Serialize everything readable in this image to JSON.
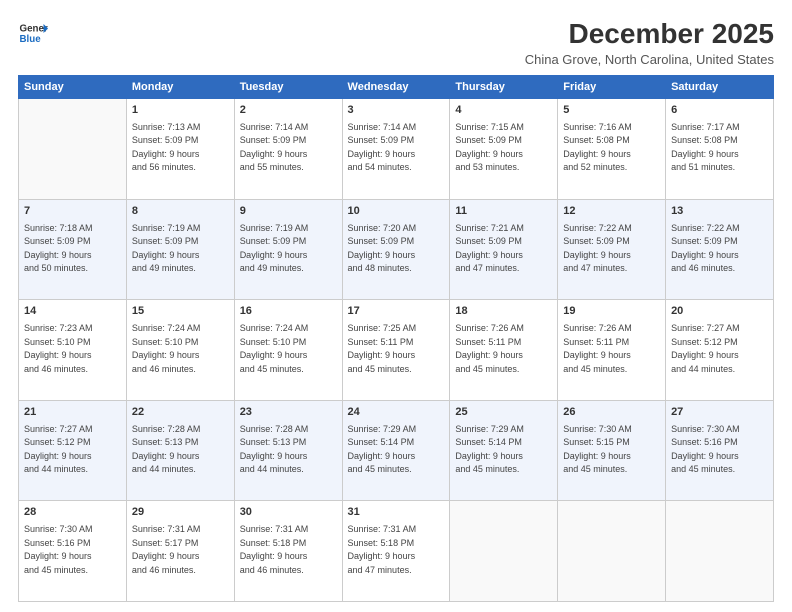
{
  "header": {
    "logo_line1": "General",
    "logo_line2": "Blue",
    "month": "December 2025",
    "location": "China Grove, North Carolina, United States"
  },
  "days_of_week": [
    "Sunday",
    "Monday",
    "Tuesday",
    "Wednesday",
    "Thursday",
    "Friday",
    "Saturday"
  ],
  "weeks": [
    [
      {
        "day": "",
        "info": ""
      },
      {
        "day": "1",
        "info": "Sunrise: 7:13 AM\nSunset: 5:09 PM\nDaylight: 9 hours\nand 56 minutes."
      },
      {
        "day": "2",
        "info": "Sunrise: 7:14 AM\nSunset: 5:09 PM\nDaylight: 9 hours\nand 55 minutes."
      },
      {
        "day": "3",
        "info": "Sunrise: 7:14 AM\nSunset: 5:09 PM\nDaylight: 9 hours\nand 54 minutes."
      },
      {
        "day": "4",
        "info": "Sunrise: 7:15 AM\nSunset: 5:09 PM\nDaylight: 9 hours\nand 53 minutes."
      },
      {
        "day": "5",
        "info": "Sunrise: 7:16 AM\nSunset: 5:08 PM\nDaylight: 9 hours\nand 52 minutes."
      },
      {
        "day": "6",
        "info": "Sunrise: 7:17 AM\nSunset: 5:08 PM\nDaylight: 9 hours\nand 51 minutes."
      }
    ],
    [
      {
        "day": "7",
        "info": "Sunrise: 7:18 AM\nSunset: 5:09 PM\nDaylight: 9 hours\nand 50 minutes."
      },
      {
        "day": "8",
        "info": "Sunrise: 7:19 AM\nSunset: 5:09 PM\nDaylight: 9 hours\nand 49 minutes."
      },
      {
        "day": "9",
        "info": "Sunrise: 7:19 AM\nSunset: 5:09 PM\nDaylight: 9 hours\nand 49 minutes."
      },
      {
        "day": "10",
        "info": "Sunrise: 7:20 AM\nSunset: 5:09 PM\nDaylight: 9 hours\nand 48 minutes."
      },
      {
        "day": "11",
        "info": "Sunrise: 7:21 AM\nSunset: 5:09 PM\nDaylight: 9 hours\nand 47 minutes."
      },
      {
        "day": "12",
        "info": "Sunrise: 7:22 AM\nSunset: 5:09 PM\nDaylight: 9 hours\nand 47 minutes."
      },
      {
        "day": "13",
        "info": "Sunrise: 7:22 AM\nSunset: 5:09 PM\nDaylight: 9 hours\nand 46 minutes."
      }
    ],
    [
      {
        "day": "14",
        "info": "Sunrise: 7:23 AM\nSunset: 5:10 PM\nDaylight: 9 hours\nand 46 minutes."
      },
      {
        "day": "15",
        "info": "Sunrise: 7:24 AM\nSunset: 5:10 PM\nDaylight: 9 hours\nand 46 minutes."
      },
      {
        "day": "16",
        "info": "Sunrise: 7:24 AM\nSunset: 5:10 PM\nDaylight: 9 hours\nand 45 minutes."
      },
      {
        "day": "17",
        "info": "Sunrise: 7:25 AM\nSunset: 5:11 PM\nDaylight: 9 hours\nand 45 minutes."
      },
      {
        "day": "18",
        "info": "Sunrise: 7:26 AM\nSunset: 5:11 PM\nDaylight: 9 hours\nand 45 minutes."
      },
      {
        "day": "19",
        "info": "Sunrise: 7:26 AM\nSunset: 5:11 PM\nDaylight: 9 hours\nand 45 minutes."
      },
      {
        "day": "20",
        "info": "Sunrise: 7:27 AM\nSunset: 5:12 PM\nDaylight: 9 hours\nand 44 minutes."
      }
    ],
    [
      {
        "day": "21",
        "info": "Sunrise: 7:27 AM\nSunset: 5:12 PM\nDaylight: 9 hours\nand 44 minutes."
      },
      {
        "day": "22",
        "info": "Sunrise: 7:28 AM\nSunset: 5:13 PM\nDaylight: 9 hours\nand 44 minutes."
      },
      {
        "day": "23",
        "info": "Sunrise: 7:28 AM\nSunset: 5:13 PM\nDaylight: 9 hours\nand 44 minutes."
      },
      {
        "day": "24",
        "info": "Sunrise: 7:29 AM\nSunset: 5:14 PM\nDaylight: 9 hours\nand 45 minutes."
      },
      {
        "day": "25",
        "info": "Sunrise: 7:29 AM\nSunset: 5:14 PM\nDaylight: 9 hours\nand 45 minutes."
      },
      {
        "day": "26",
        "info": "Sunrise: 7:30 AM\nSunset: 5:15 PM\nDaylight: 9 hours\nand 45 minutes."
      },
      {
        "day": "27",
        "info": "Sunrise: 7:30 AM\nSunset: 5:16 PM\nDaylight: 9 hours\nand 45 minutes."
      }
    ],
    [
      {
        "day": "28",
        "info": "Sunrise: 7:30 AM\nSunset: 5:16 PM\nDaylight: 9 hours\nand 45 minutes."
      },
      {
        "day": "29",
        "info": "Sunrise: 7:31 AM\nSunset: 5:17 PM\nDaylight: 9 hours\nand 46 minutes."
      },
      {
        "day": "30",
        "info": "Sunrise: 7:31 AM\nSunset: 5:18 PM\nDaylight: 9 hours\nand 46 minutes."
      },
      {
        "day": "31",
        "info": "Sunrise: 7:31 AM\nSunset: 5:18 PM\nDaylight: 9 hours\nand 47 minutes."
      },
      {
        "day": "",
        "info": ""
      },
      {
        "day": "",
        "info": ""
      },
      {
        "day": "",
        "info": ""
      }
    ]
  ]
}
